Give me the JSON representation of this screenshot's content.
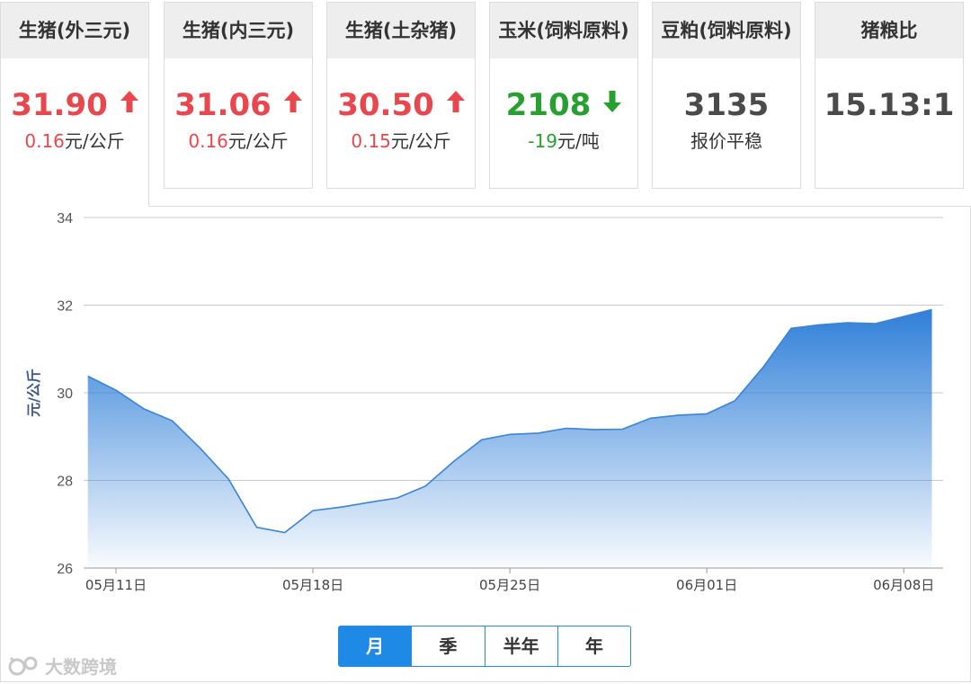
{
  "cards": [
    {
      "title": "生猪(外三元)",
      "price": "31.90",
      "trend": "up",
      "change_num": "0.16",
      "change_unit": "元/公斤"
    },
    {
      "title": "生猪(内三元)",
      "price": "31.06",
      "trend": "up",
      "change_num": "0.16",
      "change_unit": "元/公斤"
    },
    {
      "title": "生猪(土杂猪)",
      "price": "30.50",
      "trend": "up",
      "change_num": "0.15",
      "change_unit": "元/公斤"
    },
    {
      "title": "玉米(饲料原料)",
      "price": "2108",
      "trend": "down",
      "change_num": "-19",
      "change_unit": "元/吨"
    },
    {
      "title": "豆粕(饲料原料)",
      "price": "3135",
      "trend": "flat",
      "change_num": "",
      "change_unit": "报价平稳"
    },
    {
      "title": "猪粮比",
      "price": "15.13:1",
      "trend": "none",
      "change_num": "",
      "change_unit": ""
    }
  ],
  "colors": {
    "up": "#e8474e",
    "down": "#27a02f",
    "accent": "#1e8ae6",
    "series_line": "#3a84d6"
  },
  "range_tabs": [
    "月",
    "季",
    "半年",
    "年"
  ],
  "range_active": 0,
  "watermark": "大数跨境",
  "chart_data": {
    "type": "area",
    "ylabel": "元/公斤",
    "ylim": [
      26,
      34
    ],
    "yticks": [
      26,
      28,
      30,
      32,
      34
    ],
    "grid": true,
    "xticks": [
      {
        "label": "05月11日",
        "date": "2021-05-11"
      },
      {
        "label": "05月18日",
        "date": "2021-05-18"
      },
      {
        "label": "05月25日",
        "date": "2021-05-25"
      },
      {
        "label": "06月01日",
        "date": "2021-06-01"
      },
      {
        "label": "06月08日",
        "date": "2021-06-08"
      }
    ],
    "x": [
      "2021-05-10",
      "2021-05-11",
      "2021-05-12",
      "2021-05-13",
      "2021-05-14",
      "2021-05-15",
      "2021-05-16",
      "2021-05-17",
      "2021-05-18",
      "2021-05-19",
      "2021-05-20",
      "2021-05-21",
      "2021-05-22",
      "2021-05-23",
      "2021-05-24",
      "2021-05-25",
      "2021-05-26",
      "2021-05-27",
      "2021-05-28",
      "2021-05-29",
      "2021-05-30",
      "2021-05-31",
      "2021-06-01",
      "2021-06-02",
      "2021-06-03",
      "2021-06-04",
      "2021-06-05",
      "2021-06-06",
      "2021-06-07",
      "2021-06-08",
      "2021-06-09"
    ],
    "values": [
      30.38,
      30.06,
      29.63,
      29.36,
      28.73,
      28.03,
      26.93,
      26.81,
      27.31,
      27.39,
      27.5,
      27.6,
      27.87,
      28.43,
      28.93,
      29.05,
      29.08,
      29.19,
      29.16,
      29.17,
      29.42,
      29.49,
      29.52,
      29.82,
      30.58,
      31.47,
      31.55,
      31.6,
      31.58,
      31.74,
      31.9
    ]
  }
}
